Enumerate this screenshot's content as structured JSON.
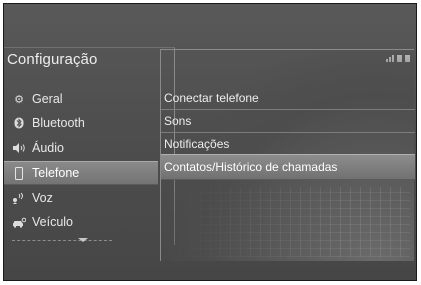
{
  "header": {
    "title": "Configuração"
  },
  "sidebar": {
    "items": [
      {
        "label": "Geral",
        "icon": "gear-icon",
        "selected": false
      },
      {
        "label": "Bluetooth",
        "icon": "bluetooth-icon",
        "selected": false
      },
      {
        "label": "Áudio",
        "icon": "speaker-icon",
        "selected": false
      },
      {
        "label": "Telefone",
        "icon": "phone-icon",
        "selected": true
      },
      {
        "label": "Voz",
        "icon": "voice-icon",
        "selected": false
      },
      {
        "label": "Veículo",
        "icon": "car-icon",
        "selected": false
      }
    ]
  },
  "main": {
    "items": [
      {
        "label": "Conectar telefone",
        "selected": false
      },
      {
        "label": "Sons",
        "selected": false
      },
      {
        "label": "Notificações",
        "selected": false
      },
      {
        "label": "Contatos/Histórico de chamadas",
        "selected": true
      }
    ]
  },
  "icons": {
    "status": "signal-status-icon",
    "more": "chevron-down-icon"
  }
}
